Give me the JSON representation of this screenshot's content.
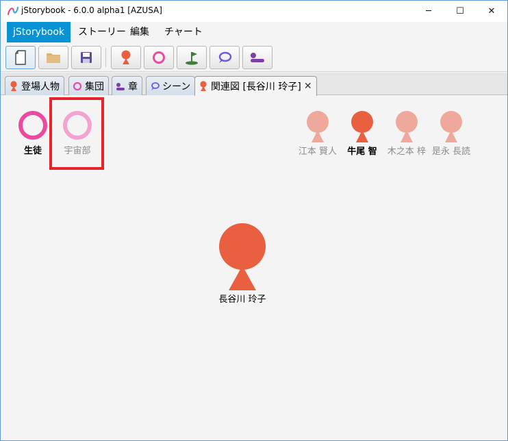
{
  "window": {
    "title": "jStorybook - 6.0.0 alpha1 [AZUSA]",
    "controls": {
      "minimize": "─",
      "maximize": "☐",
      "close": "✕"
    }
  },
  "menu": {
    "items": [
      {
        "label": "jStorybook",
        "active": true
      },
      {
        "label": "ストーリー",
        "active": false
      },
      {
        "label": "編集",
        "active": false
      },
      {
        "label": "チャート",
        "active": false
      }
    ]
  },
  "toolbar": {
    "buttons": [
      {
        "icon": "new-file-icon"
      },
      {
        "icon": "folder-icon"
      },
      {
        "icon": "save-icon"
      },
      {
        "icon": "person-icon"
      },
      {
        "icon": "group-ring-icon"
      },
      {
        "icon": "place-flag-icon"
      },
      {
        "icon": "scene-bubble-icon"
      },
      {
        "icon": "chapter-icon"
      }
    ]
  },
  "tabs": [
    {
      "label": "登場人物",
      "icon": "person-icon"
    },
    {
      "label": "集団",
      "icon": "group-ring-icon"
    },
    {
      "label": "章",
      "icon": "chapter-icon"
    },
    {
      "label": "シーン",
      "icon": "scene-bubble-icon"
    },
    {
      "label": "関連図 [長谷川 玲子]",
      "icon": "person-icon",
      "active": true,
      "close": "✕"
    }
  ],
  "diagram": {
    "groups": [
      {
        "label": "生徒",
        "color": "#ea4aa0",
        "emphasis": "strong"
      },
      {
        "label": "宇宙部",
        "color": "#f2a3cf",
        "emphasis": "dim"
      }
    ],
    "persons": [
      {
        "label": "江本 賢人",
        "color": "#eea99c",
        "emphasis": "dim"
      },
      {
        "label": "牛尾 智",
        "color": "#e8603f",
        "emphasis": "strong"
      },
      {
        "label": "木之本 梓",
        "color": "#eea99c",
        "emphasis": "dim"
      },
      {
        "label": "是永 長読",
        "color": "#eea99c",
        "emphasis": "dim"
      }
    ],
    "center": {
      "label": "長谷川 玲子",
      "color": "#e8603f"
    }
  },
  "colors": {
    "accent": "#0a93d4",
    "person_main": "#e8603f",
    "highlight": "#e8242b"
  }
}
